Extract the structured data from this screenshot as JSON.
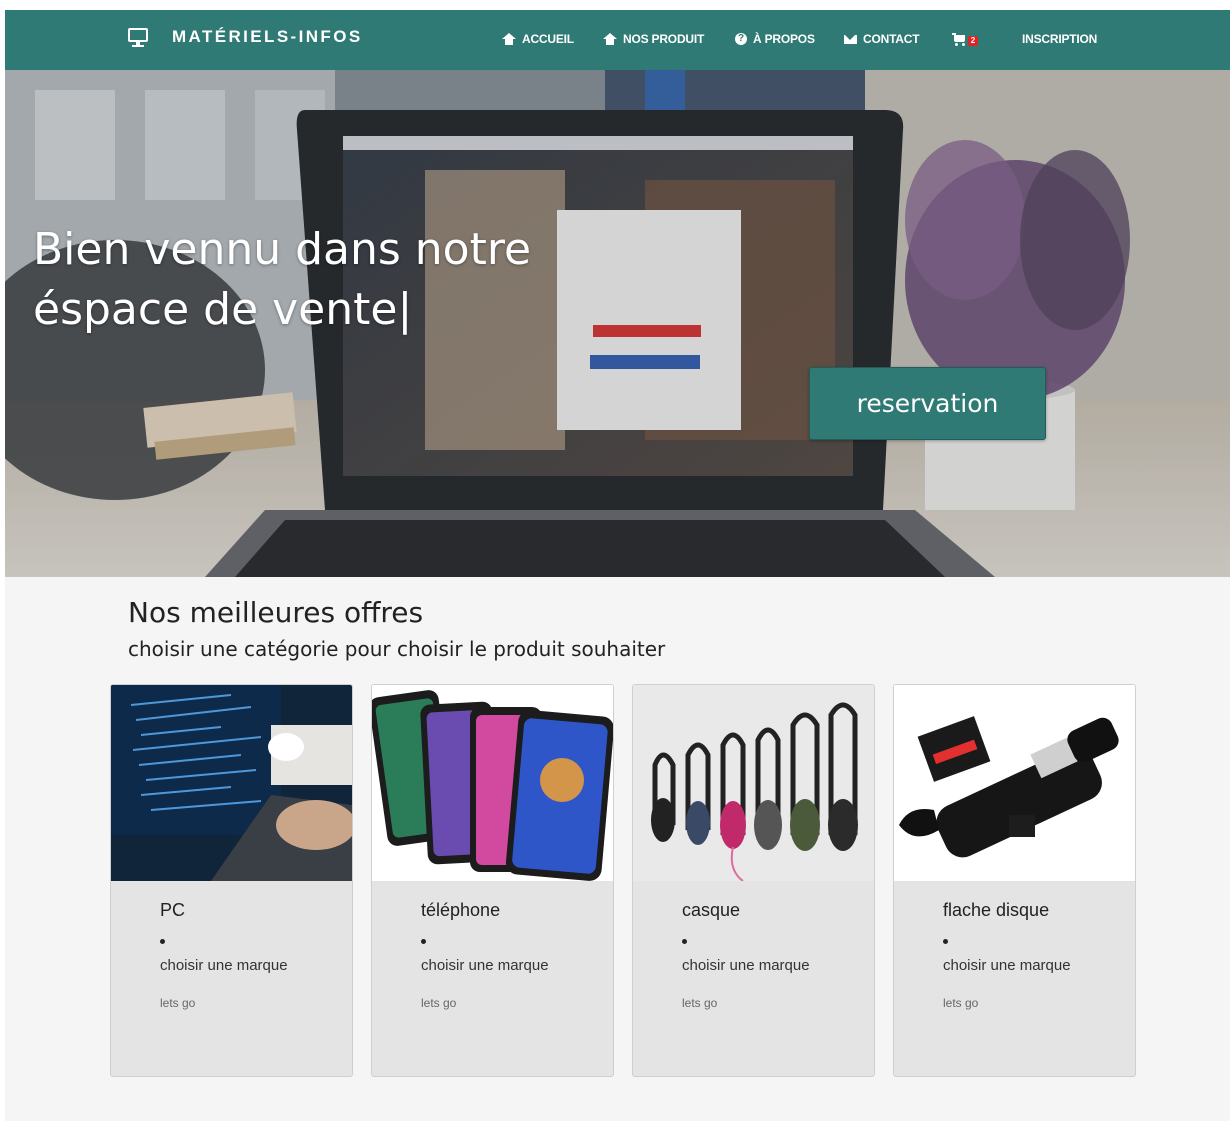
{
  "brand": {
    "name": "MATÉRIELS-INFOS",
    "icon": "monitor-icon"
  },
  "nav": {
    "items": [
      {
        "label": "ACCUEIL",
        "icon": "home-icon"
      },
      {
        "label": "NOS PRODUIT",
        "icon": "home-icon"
      },
      {
        "label": "À PROPOS",
        "icon": "help-icon"
      },
      {
        "label": "CONTACT",
        "icon": "mail-icon"
      }
    ],
    "cart_count": "2",
    "signup": "INSCRIPTION"
  },
  "hero": {
    "title_line1": "Bien vennu dans notre",
    "title_line2": "éspace de vente",
    "caret": "|",
    "button": "reservation"
  },
  "offers": {
    "title": "Nos meilleures offres",
    "subtitle": "choisir une catégorie pour choisir le produit souhaiter",
    "cards": [
      {
        "name": "PC",
        "link": "choisir une marque",
        "cta": "lets go"
      },
      {
        "name": "téléphone",
        "link": "choisir une marque",
        "cta": "lets go"
      },
      {
        "name": "casque",
        "link": "choisir une marque",
        "cta": "lets go"
      },
      {
        "name": "flache disque",
        "link": "choisir une marque",
        "cta": "lets go"
      }
    ]
  },
  "colors": {
    "accent": "#2f7a74",
    "badge": "#e02424",
    "page_bg": "#f5f5f5",
    "card_bg": "#e4e4e4"
  }
}
